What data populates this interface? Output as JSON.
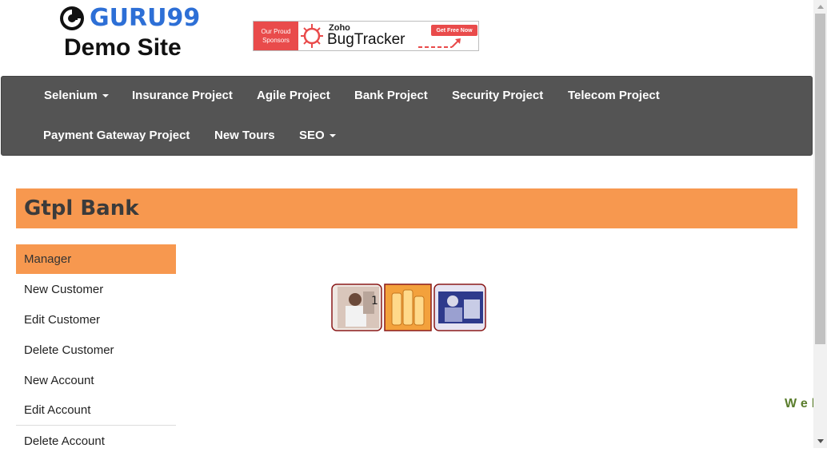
{
  "header": {
    "logo_text": "GURU99",
    "subtitle": "Demo Site",
    "ad": {
      "left_line1": "Our Proud",
      "left_line2": "Sponsors",
      "brand_small": "Zoho",
      "brand_large": "BugTracker",
      "cta": "Get Free Now"
    }
  },
  "nav": {
    "items": [
      {
        "label": "Selenium",
        "dropdown": true
      },
      {
        "label": "Insurance Project",
        "dropdown": false
      },
      {
        "label": "Agile Project",
        "dropdown": false
      },
      {
        "label": "Bank Project",
        "dropdown": false
      },
      {
        "label": "Security Project",
        "dropdown": false
      },
      {
        "label": "Telecom Project",
        "dropdown": false
      },
      {
        "label": "Payment Gateway Project",
        "dropdown": false
      },
      {
        "label": "New Tours",
        "dropdown": false
      },
      {
        "label": "SEO",
        "dropdown": true
      }
    ]
  },
  "bank": {
    "title": "Gtpl Bank"
  },
  "sidebar": {
    "items": [
      {
        "label": "Manager"
      },
      {
        "label": "New Customer"
      },
      {
        "label": "Edit Customer"
      },
      {
        "label": "Delete Customer"
      },
      {
        "label": "New Account"
      },
      {
        "label": "Edit Account"
      },
      {
        "label": "Delete Account"
      }
    ]
  },
  "welcome_marquee": "Wel",
  "colors": {
    "accent_orange": "#f7984f",
    "navbar": "#545454",
    "logo_blue": "#2d6fd6",
    "welcome_green": "#5a7d2c"
  }
}
